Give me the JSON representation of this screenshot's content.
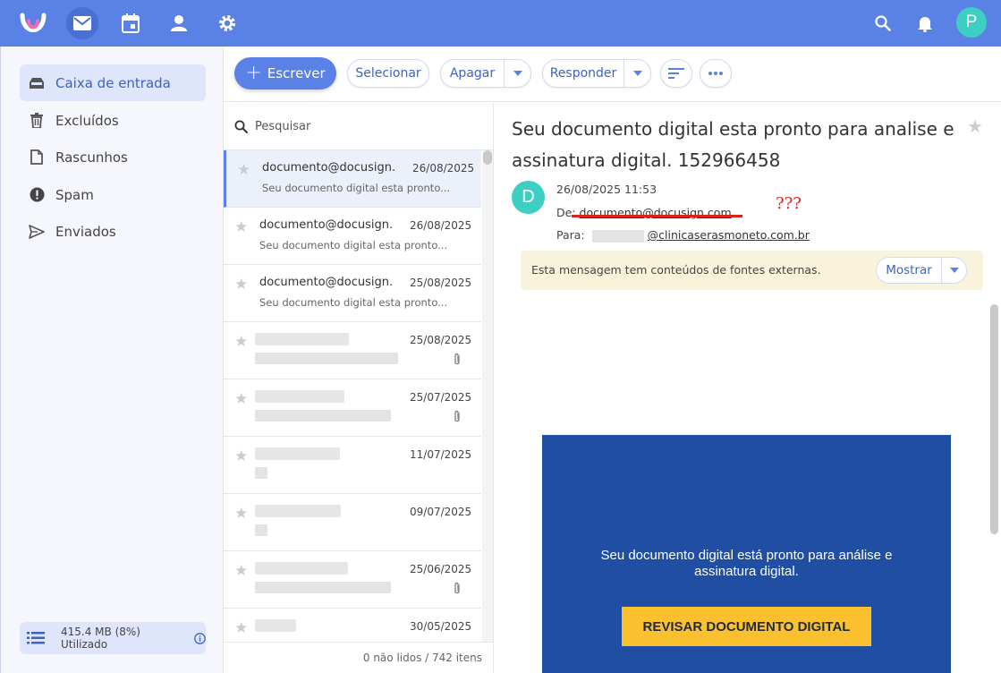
{
  "sidebar": {
    "items": [
      {
        "label": "Caixa de entrada",
        "icon": "inbox-icon"
      },
      {
        "label": "Excluídos",
        "icon": "trash-icon"
      },
      {
        "label": "Rascunhos",
        "icon": "draft-icon"
      },
      {
        "label": "Spam",
        "icon": "spam-icon"
      },
      {
        "label": "Enviados",
        "icon": "send-icon"
      }
    ],
    "storage": "415.4 MB (8%) Utilizado"
  },
  "topbar": {
    "avatar_initial": "P",
    "accent": "#5a82e6"
  },
  "toolbar": {
    "compose": "Escrever",
    "select": "Selecionar",
    "delete": "Apagar",
    "reply": "Responder"
  },
  "list": {
    "search_placeholder": "Pesquisar",
    "messages": [
      {
        "from": "documento@docusign.com",
        "date": "26/08/2025",
        "preview": "Seu documento digital esta pronto..."
      },
      {
        "from": "documento@docusign.com",
        "date": "26/08/2025",
        "preview": "Seu documento digital esta pronto..."
      },
      {
        "from": "documento@docusign.com",
        "date": "25/08/2025",
        "preview": "Seu documento digital esta pronto..."
      },
      {
        "date": "25/08/2025"
      },
      {
        "date": "25/07/2025"
      },
      {
        "date": "11/07/2025"
      },
      {
        "date": "09/07/2025"
      },
      {
        "date": "25/06/2025"
      },
      {
        "date": "30/05/2025"
      }
    ],
    "footer": "0 não lidos / 742 itens"
  },
  "reader": {
    "subject": "Seu documento digital esta pronto para analise e assinatura digital. 152966458",
    "sender_initial": "D",
    "datetime": "26/08/2025 11:53",
    "from_label": "De:",
    "from_address": "documento@docusign.com",
    "to_label": "Para:",
    "to_address": "@clinicaserasmoneto.com.br",
    "annotation": "???",
    "external_notice": "Esta mensagem tem conteúdos de fontes externas.",
    "show_button": "Mostrar",
    "body_message": "Seu documento digital está pronto para análise e assinatura digital.",
    "cta_button": "REVISAR DOCUMENTO DIGITAL",
    "card_color": "#1f4ea3",
    "cta_color": "#fbc02d"
  }
}
